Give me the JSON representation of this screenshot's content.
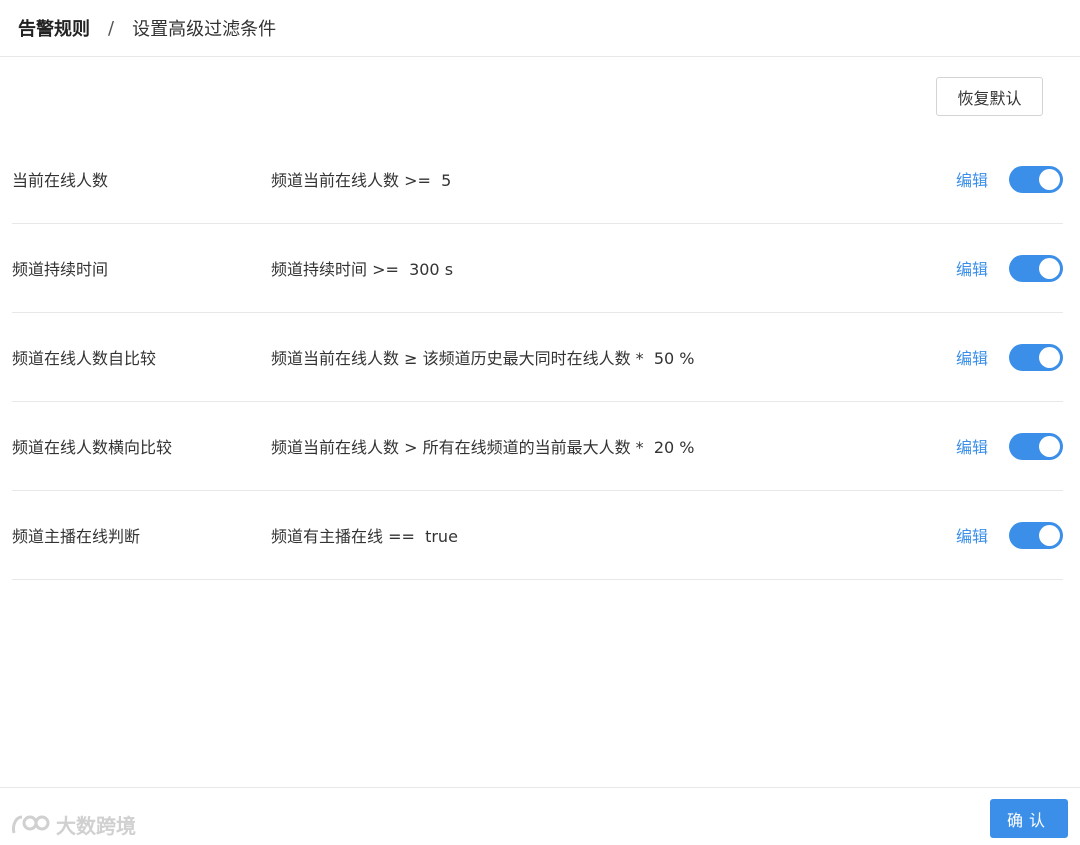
{
  "breadcrumb": {
    "root": "告警规则",
    "separator": "/",
    "current": "设置高级过滤条件"
  },
  "toolbar": {
    "reset_label": "恢复默认"
  },
  "rules": [
    {
      "name": "当前在线人数",
      "condition": "频道当前在线人数 >=  5",
      "edit_label": "编辑",
      "enabled": true
    },
    {
      "name": "频道持续时间",
      "condition": "频道持续时间 >=  300 s",
      "edit_label": "编辑",
      "enabled": true
    },
    {
      "name": "频道在线人数自比较",
      "condition": "频道当前在线人数 ≥ 该频道历史最大同时在线人数 *  50 %",
      "edit_label": "编辑",
      "enabled": true
    },
    {
      "name": "频道在线人数横向比较",
      "condition": "频道当前在线人数 > 所有在线频道的当前最大人数 *  20 %",
      "edit_label": "编辑",
      "enabled": true
    },
    {
      "name": "频道主播在线判断",
      "condition": "频道有主播在线 ==  true",
      "edit_label": "编辑",
      "enabled": true
    }
  ],
  "footer": {
    "confirm_label": "确认",
    "watermark_text": "大数跨境"
  },
  "colors": {
    "accent": "#3b8fe8",
    "divider": "#e8e8e8"
  }
}
